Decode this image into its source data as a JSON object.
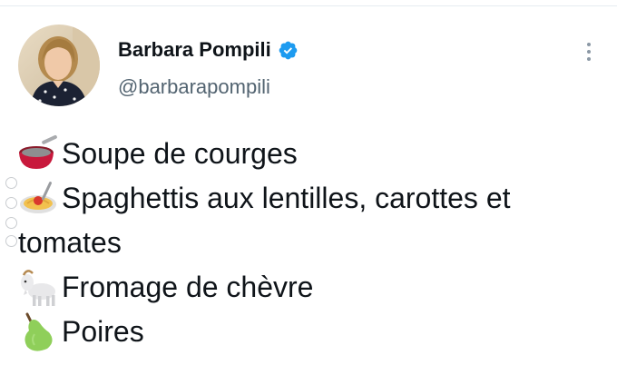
{
  "author": {
    "display_name": "Barbara Pompili",
    "handle": "@barbarapompili",
    "verified": true,
    "avatar_icon": "profile-photo",
    "verified_icon": "verified-badge-icon"
  },
  "actions": {
    "more_icon": "more-options-icon"
  },
  "tweet": {
    "lines": [
      {
        "emoji": "soup-bowl",
        "text": "Soupe de courges"
      },
      {
        "emoji": "spaghetti",
        "text": "Spaghettis aux lentilles, carottes et"
      },
      {
        "emoji": "",
        "text": "tomates"
      },
      {
        "emoji": "goat",
        "text": "Fromage de chèvre"
      },
      {
        "emoji": "pear",
        "text": "Poires"
      }
    ]
  },
  "colors": {
    "text": "#0f1419",
    "secondary": "#536471",
    "verified": "#1d9bf0",
    "divider": "#e6ecf0"
  }
}
